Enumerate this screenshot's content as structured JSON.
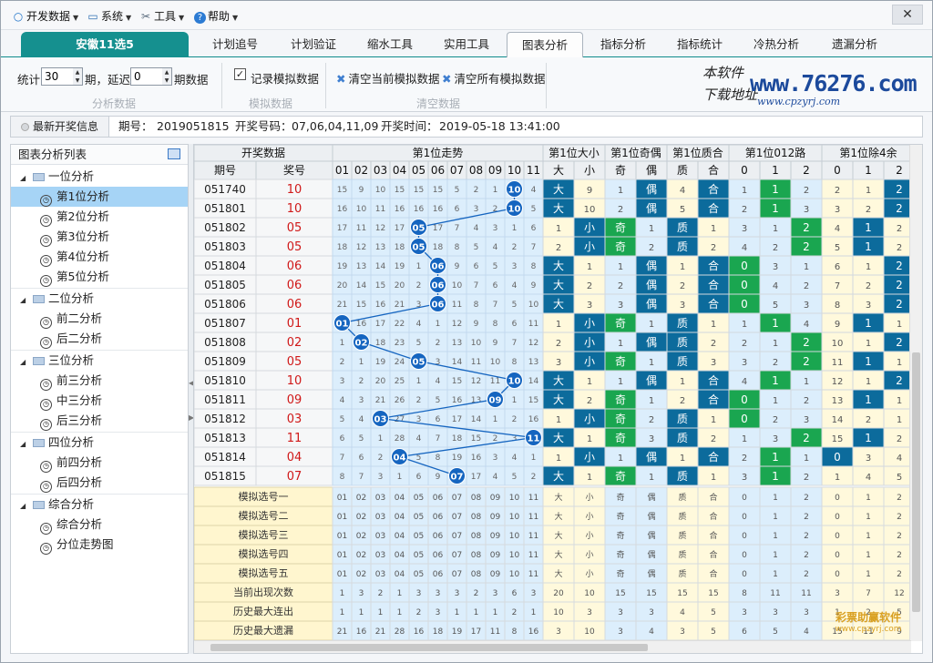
{
  "menu": [
    {
      "label": "开发数据",
      "icon": "circle-o-icon"
    },
    {
      "label": "系统",
      "icon": "monitor-icon"
    },
    {
      "label": "工具",
      "icon": "tools-icon"
    },
    {
      "label": "帮助",
      "icon": "help-icon"
    }
  ],
  "window": {
    "close_label": "✕"
  },
  "lottery_tab": "安徽11选5",
  "tabs": [
    "计划追号",
    "计划验证",
    "缩水工具",
    "实用工具",
    "图表分析",
    "指标分析",
    "指标统计",
    "冷热分析",
    "遗漏分析"
  ],
  "active_tab": "图表分析",
  "toolbar": {
    "stat_label": "统计",
    "stat_value": "30",
    "period_label": "期，延迟",
    "delay_value": "0",
    "period_data_label": "期数据",
    "group1_title": "分析数据",
    "record_label": "记录模拟数据",
    "record_checked": true,
    "group2_title": "模拟数据",
    "clear_current_label": "清空当前模拟数据",
    "clear_all_label": "清空所有模拟数据",
    "group3_title": "清空数据"
  },
  "logo": {
    "line1": "本软件",
    "line2": "下载地址",
    "domain": "www.76276.com",
    "sub": "www.cpzyrj.com"
  },
  "info": {
    "latest_button": "最新开奖信息",
    "period_label": "期号：",
    "period_value": "2019051815",
    "numbers_label": "开奖号码：",
    "numbers_value": "07,06,04,11,09",
    "time_label": "开奖时间：",
    "time_value": "2019-05-18 13:41:00"
  },
  "sidebar": {
    "title": "图表分析列表",
    "groups": [
      {
        "label": "一位分析",
        "items": [
          "第1位分析",
          "第2位分析",
          "第3位分析",
          "第4位分析",
          "第5位分析"
        ]
      },
      {
        "label": "二位分析",
        "items": [
          "前二分析",
          "后二分析"
        ]
      },
      {
        "label": "三位分析",
        "items": [
          "前三分析",
          "中三分析",
          "后三分析"
        ]
      },
      {
        "label": "四位分析",
        "items": [
          "前四分析",
          "后四分析"
        ]
      },
      {
        "label": "综合分析",
        "items": [
          "综合分析",
          "分位走势图"
        ]
      }
    ],
    "selected": "第1位分析"
  },
  "grid": {
    "group_headers": [
      "开奖数据",
      "第1位走势",
      "第1位大小",
      "第1位奇偶",
      "第1位质合",
      "第1位012路",
      "第1位除4余"
    ],
    "sub_headers": [
      "期号",
      "奖号",
      "01",
      "02",
      "03",
      "04",
      "05",
      "06",
      "07",
      "08",
      "09",
      "10",
      "11",
      "大",
      "小",
      "奇",
      "偶",
      "质",
      "合",
      "0",
      "1",
      "2",
      "0",
      "1",
      "2"
    ],
    "rows": [
      {
        "period": "051740",
        "prize": "10",
        "trend": [
          15,
          9,
          10,
          15,
          15,
          15,
          5,
          2,
          1,
          "10",
          4
        ],
        "bs": [
          "大",
          9
        ],
        "oe": [
          1,
          "偶"
        ],
        "pc": [
          4,
          "合"
        ],
        "r3": [
          1,
          "1",
          2
        ],
        "r4": [
          2,
          1,
          "2"
        ]
      },
      {
        "period": "051801",
        "prize": "10",
        "trend": [
          16,
          10,
          11,
          16,
          16,
          16,
          6,
          3,
          2,
          "10",
          5
        ],
        "bs": [
          "大",
          10
        ],
        "oe": [
          2,
          "偶"
        ],
        "pc": [
          5,
          "合"
        ],
        "r3": [
          2,
          "1",
          3
        ],
        "r4": [
          3,
          2,
          "2"
        ]
      },
      {
        "period": "051802",
        "prize": "05",
        "trend": [
          17,
          11,
          12,
          17,
          "05",
          17,
          7,
          4,
          3,
          1,
          6
        ],
        "bs": [
          1,
          "小"
        ],
        "oe": [
          "奇",
          1
        ],
        "pc": [
          "质",
          1
        ],
        "r3": [
          3,
          1,
          "2"
        ],
        "r4": [
          4,
          "1",
          2
        ]
      },
      {
        "period": "051803",
        "prize": "05",
        "trend": [
          18,
          12,
          13,
          18,
          "05",
          18,
          8,
          5,
          4,
          2,
          7
        ],
        "bs": [
          2,
          "小"
        ],
        "oe": [
          "奇",
          2
        ],
        "pc": [
          "质",
          2
        ],
        "r3": [
          4,
          2,
          "2"
        ],
        "r4": [
          5,
          "1",
          2
        ]
      },
      {
        "period": "051804",
        "prize": "06",
        "trend": [
          19,
          13,
          14,
          19,
          1,
          "06",
          9,
          6,
          5,
          3,
          8
        ],
        "bs": [
          "大",
          1
        ],
        "oe": [
          1,
          "偶"
        ],
        "pc": [
          1,
          "合"
        ],
        "r3": [
          "0",
          3,
          1
        ],
        "r4": [
          6,
          1,
          "2"
        ]
      },
      {
        "period": "051805",
        "prize": "06",
        "trend": [
          20,
          14,
          15,
          20,
          2,
          "06",
          10,
          7,
          6,
          4,
          9
        ],
        "bs": [
          "大",
          2
        ],
        "oe": [
          2,
          "偶"
        ],
        "pc": [
          2,
          "合"
        ],
        "r3": [
          "0",
          4,
          2
        ],
        "r4": [
          7,
          2,
          "2"
        ]
      },
      {
        "period": "051806",
        "prize": "06",
        "trend": [
          21,
          15,
          16,
          21,
          3,
          "06",
          11,
          8,
          7,
          5,
          10
        ],
        "bs": [
          "大",
          3
        ],
        "oe": [
          3,
          "偶"
        ],
        "pc": [
          3,
          "合"
        ],
        "r3": [
          "0",
          5,
          3
        ],
        "r4": [
          8,
          3,
          "2"
        ]
      },
      {
        "period": "051807",
        "prize": "01",
        "trend": [
          "01",
          16,
          17,
          22,
          4,
          1,
          12,
          9,
          8,
          6,
          11
        ],
        "bs": [
          1,
          "小"
        ],
        "oe": [
          "奇",
          1
        ],
        "pc": [
          "质",
          1
        ],
        "r3": [
          1,
          "1",
          4
        ],
        "r4": [
          9,
          "1",
          1
        ]
      },
      {
        "period": "051808",
        "prize": "02",
        "trend": [
          1,
          "02",
          18,
          23,
          5,
          2,
          13,
          10,
          9,
          7,
          12
        ],
        "bs": [
          2,
          "小"
        ],
        "oe": [
          1,
          "偶"
        ],
        "pc": [
          "质",
          2
        ],
        "r3": [
          2,
          1,
          "2"
        ],
        "r4": [
          10,
          1,
          "2"
        ]
      },
      {
        "period": "051809",
        "prize": "05",
        "trend": [
          2,
          1,
          19,
          24,
          "05",
          3,
          14,
          11,
          10,
          8,
          13
        ],
        "bs": [
          3,
          "小"
        ],
        "oe": [
          "奇",
          1
        ],
        "pc": [
          "质",
          3
        ],
        "r3": [
          3,
          2,
          "2"
        ],
        "r4": [
          11,
          "1",
          1
        ]
      },
      {
        "period": "051810",
        "prize": "10",
        "trend": [
          3,
          2,
          20,
          25,
          1,
          4,
          15,
          12,
          11,
          "10",
          14
        ],
        "bs": [
          "大",
          1
        ],
        "oe": [
          1,
          "偶"
        ],
        "pc": [
          1,
          "合"
        ],
        "r3": [
          4,
          "1",
          1
        ],
        "r4": [
          12,
          1,
          "2"
        ]
      },
      {
        "period": "051811",
        "prize": "09",
        "trend": [
          4,
          3,
          21,
          26,
          2,
          5,
          16,
          13,
          "09",
          1,
          15
        ],
        "bs": [
          "大",
          2
        ],
        "oe": [
          "奇",
          1
        ],
        "pc": [
          2,
          "合"
        ],
        "r3": [
          "0",
          1,
          2
        ],
        "r4": [
          13,
          "1",
          1
        ]
      },
      {
        "period": "051812",
        "prize": "03",
        "trend": [
          5,
          4,
          "03",
          27,
          3,
          6,
          17,
          14,
          1,
          2,
          16
        ],
        "bs": [
          1,
          "小"
        ],
        "oe": [
          "奇",
          2
        ],
        "pc": [
          "质",
          1
        ],
        "r3": [
          "0",
          2,
          3
        ],
        "r4": [
          14,
          2,
          1
        ]
      },
      {
        "period": "051813",
        "prize": "11",
        "trend": [
          6,
          5,
          1,
          28,
          4,
          7,
          18,
          15,
          2,
          3,
          "11"
        ],
        "bs": [
          "大",
          1
        ],
        "oe": [
          "奇",
          3
        ],
        "pc": [
          "质",
          2
        ],
        "r3": [
          1,
          3,
          "2"
        ],
        "r4": [
          15,
          "1",
          2
        ]
      },
      {
        "period": "051814",
        "prize": "04",
        "trend": [
          7,
          6,
          2,
          "04",
          5,
          8,
          19,
          16,
          3,
          4,
          1
        ],
        "bs": [
          1,
          "小"
        ],
        "oe": [
          1,
          "偶"
        ],
        "pc": [
          1,
          "合"
        ],
        "r3": [
          2,
          "1",
          1
        ],
        "r4": [
          "0",
          3,
          4
        ]
      },
      {
        "period": "051815",
        "prize": "07",
        "trend": [
          8,
          7,
          3,
          1,
          6,
          9,
          "07",
          17,
          4,
          5,
          2
        ],
        "bs": [
          "大",
          1
        ],
        "oe": [
          "奇",
          1
        ],
        "pc": [
          "质",
          1
        ],
        "r3": [
          3,
          "1",
          2
        ],
        "r4": [
          1,
          4,
          5
        ]
      }
    ],
    "sim_rows": [
      {
        "label": "模拟选号一",
        "cells": [
          "01",
          "02",
          "03",
          "04",
          "05",
          "06",
          "07",
          "08",
          "09",
          "10",
          "11",
          "大",
          "小",
          "奇",
          "偶",
          "质",
          "合",
          "0",
          "1",
          "2",
          "0",
          "1",
          "2"
        ]
      },
      {
        "label": "模拟选号二",
        "cells": [
          "01",
          "02",
          "03",
          "04",
          "05",
          "06",
          "07",
          "08",
          "09",
          "10",
          "11",
          "大",
          "小",
          "奇",
          "偶",
          "质",
          "合",
          "0",
          "1",
          "2",
          "0",
          "1",
          "2"
        ]
      },
      {
        "label": "模拟选号三",
        "cells": [
          "01",
          "02",
          "03",
          "04",
          "05",
          "06",
          "07",
          "08",
          "09",
          "10",
          "11",
          "大",
          "小",
          "奇",
          "偶",
          "质",
          "合",
          "0",
          "1",
          "2",
          "0",
          "1",
          "2"
        ]
      },
      {
        "label": "模拟选号四",
        "cells": [
          "01",
          "02",
          "03",
          "04",
          "05",
          "06",
          "07",
          "08",
          "09",
          "10",
          "11",
          "大",
          "小",
          "奇",
          "偶",
          "质",
          "合",
          "0",
          "1",
          "2",
          "0",
          "1",
          "2"
        ]
      },
      {
        "label": "模拟选号五",
        "cells": [
          "01",
          "02",
          "03",
          "04",
          "05",
          "06",
          "07",
          "08",
          "09",
          "10",
          "11",
          "大",
          "小",
          "奇",
          "偶",
          "质",
          "合",
          "0",
          "1",
          "2",
          "0",
          "1",
          "2"
        ]
      }
    ],
    "stat_rows": [
      {
        "label": "当前出现次数",
        "cells": [
          "1",
          "3",
          "2",
          "1",
          "3",
          "3",
          "3",
          "2",
          "3",
          "6",
          "3",
          "20",
          "10",
          "15",
          "15",
          "15",
          "15",
          "8",
          "11",
          "11",
          "3",
          "7",
          "12"
        ]
      },
      {
        "label": "历史最大连出",
        "cells": [
          "1",
          "1",
          "1",
          "1",
          "2",
          "3",
          "1",
          "1",
          "1",
          "2",
          "1",
          "10",
          "3",
          "3",
          "3",
          "4",
          "5",
          "3",
          "3",
          "3",
          "1",
          "2",
          "5"
        ]
      },
      {
        "label": "历史最大遗漏",
        "cells": [
          "21",
          "16",
          "21",
          "28",
          "16",
          "18",
          "19",
          "17",
          "11",
          "8",
          "16",
          "3",
          "10",
          "3",
          "4",
          "3",
          "5",
          "6",
          "5",
          "4",
          "15",
          "11",
          "9"
        ]
      }
    ]
  },
  "watermark": {
    "text": "彩票助赢软件",
    "sub": "www.cpzyrj.com"
  },
  "colors": {
    "teal": "#15908f",
    "ball": "#1565c0",
    "dark_cell": "#0c6b9c",
    "green_cell": "#1aa650",
    "lightblue": "#dceefc",
    "cream": "#fff9dc"
  }
}
